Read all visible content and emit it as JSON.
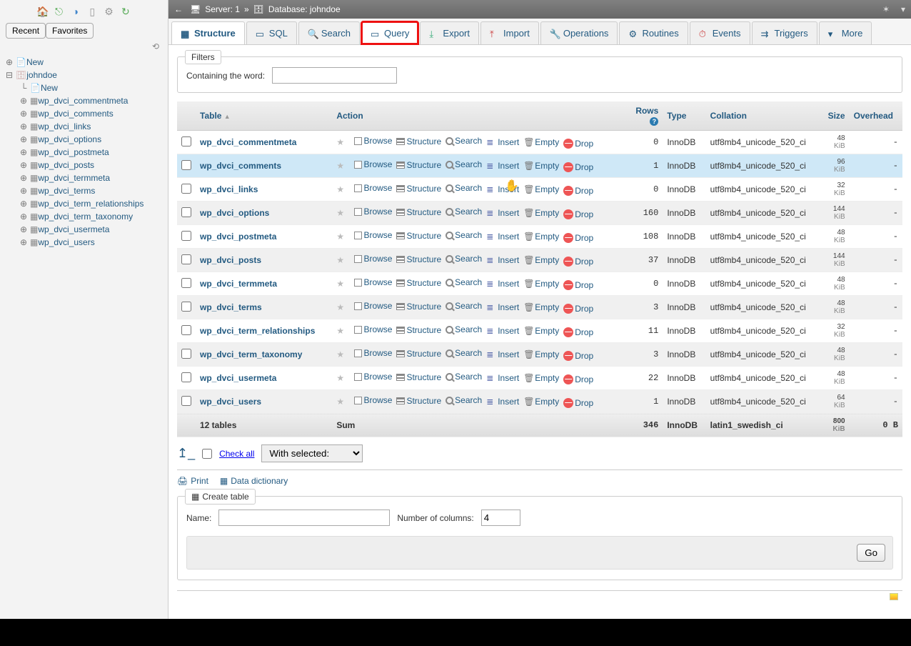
{
  "sidebar": {
    "tabs": {
      "recent": "Recent",
      "favorites": "Favorites"
    },
    "tree": {
      "new": "New",
      "db": "johndoe",
      "db_new": "New",
      "tables": [
        "wp_dvci_commentmeta",
        "wp_dvci_comments",
        "wp_dvci_links",
        "wp_dvci_options",
        "wp_dvci_postmeta",
        "wp_dvci_posts",
        "wp_dvci_termmeta",
        "wp_dvci_terms",
        "wp_dvci_term_relationships",
        "wp_dvci_term_taxonomy",
        "wp_dvci_usermeta",
        "wp_dvci_users"
      ]
    }
  },
  "breadcrumb": {
    "server_label": "Server:",
    "server_value": "1",
    "sep": "»",
    "db_label": "Database:",
    "db_value": "johndoe"
  },
  "tabs": {
    "structure": "Structure",
    "sql": "SQL",
    "search": "Search",
    "query": "Query",
    "export": "Export",
    "import": "Import",
    "operations": "Operations",
    "routines": "Routines",
    "events": "Events",
    "triggers": "Triggers",
    "more": "More"
  },
  "filters": {
    "legend": "Filters",
    "label": "Containing the word:",
    "value": ""
  },
  "columns": {
    "table": "Table",
    "action": "Action",
    "rows": "Rows",
    "type": "Type",
    "collation": "Collation",
    "size": "Size",
    "overhead": "Overhead"
  },
  "actions": {
    "browse": "Browse",
    "structure": "Structure",
    "search": "Search",
    "insert": "Insert",
    "empty": "Empty",
    "drop": "Drop"
  },
  "kib": "KiB",
  "tables": [
    {
      "name": "wp_dvci_commentmeta",
      "rows": "0",
      "type": "InnoDB",
      "collation": "utf8mb4_unicode_520_ci",
      "size": "48",
      "overhead": "-"
    },
    {
      "name": "wp_dvci_comments",
      "rows": "1",
      "type": "InnoDB",
      "collation": "utf8mb4_unicode_520_ci",
      "size": "96",
      "overhead": "-",
      "hover": true
    },
    {
      "name": "wp_dvci_links",
      "rows": "0",
      "type": "InnoDB",
      "collation": "utf8mb4_unicode_520_ci",
      "size": "32",
      "overhead": "-"
    },
    {
      "name": "wp_dvci_options",
      "rows": "160",
      "type": "InnoDB",
      "collation": "utf8mb4_unicode_520_ci",
      "size": "144",
      "overhead": "-"
    },
    {
      "name": "wp_dvci_postmeta",
      "rows": "108",
      "type": "InnoDB",
      "collation": "utf8mb4_unicode_520_ci",
      "size": "48",
      "overhead": "-"
    },
    {
      "name": "wp_dvci_posts",
      "rows": "37",
      "type": "InnoDB",
      "collation": "utf8mb4_unicode_520_ci",
      "size": "144",
      "overhead": "-"
    },
    {
      "name": "wp_dvci_termmeta",
      "rows": "0",
      "type": "InnoDB",
      "collation": "utf8mb4_unicode_520_ci",
      "size": "48",
      "overhead": "-"
    },
    {
      "name": "wp_dvci_terms",
      "rows": "3",
      "type": "InnoDB",
      "collation": "utf8mb4_unicode_520_ci",
      "size": "48",
      "overhead": "-"
    },
    {
      "name": "wp_dvci_term_relationships",
      "rows": "11",
      "type": "InnoDB",
      "collation": "utf8mb4_unicode_520_ci",
      "size": "32",
      "overhead": "-"
    },
    {
      "name": "wp_dvci_term_taxonomy",
      "rows": "3",
      "type": "InnoDB",
      "collation": "utf8mb4_unicode_520_ci",
      "size": "48",
      "overhead": "-"
    },
    {
      "name": "wp_dvci_usermeta",
      "rows": "22",
      "type": "InnoDB",
      "collation": "utf8mb4_unicode_520_ci",
      "size": "48",
      "overhead": "-"
    },
    {
      "name": "wp_dvci_users",
      "rows": "1",
      "type": "InnoDB",
      "collation": "utf8mb4_unicode_520_ci",
      "size": "64",
      "overhead": "-"
    }
  ],
  "summary": {
    "label": "12 tables",
    "sum": "Sum",
    "rows": "346",
    "type": "InnoDB",
    "collation": "latin1_swedish_ci",
    "size": "800",
    "overhead": "0 B"
  },
  "checkall": {
    "label": "Check all",
    "withselected": "With selected:"
  },
  "bottom": {
    "print": "Print",
    "datadict": "Data dictionary"
  },
  "create": {
    "legend": "Create table",
    "name_label": "Name:",
    "name_value": "",
    "cols_label": "Number of columns:",
    "cols_value": "4",
    "go": "Go"
  }
}
